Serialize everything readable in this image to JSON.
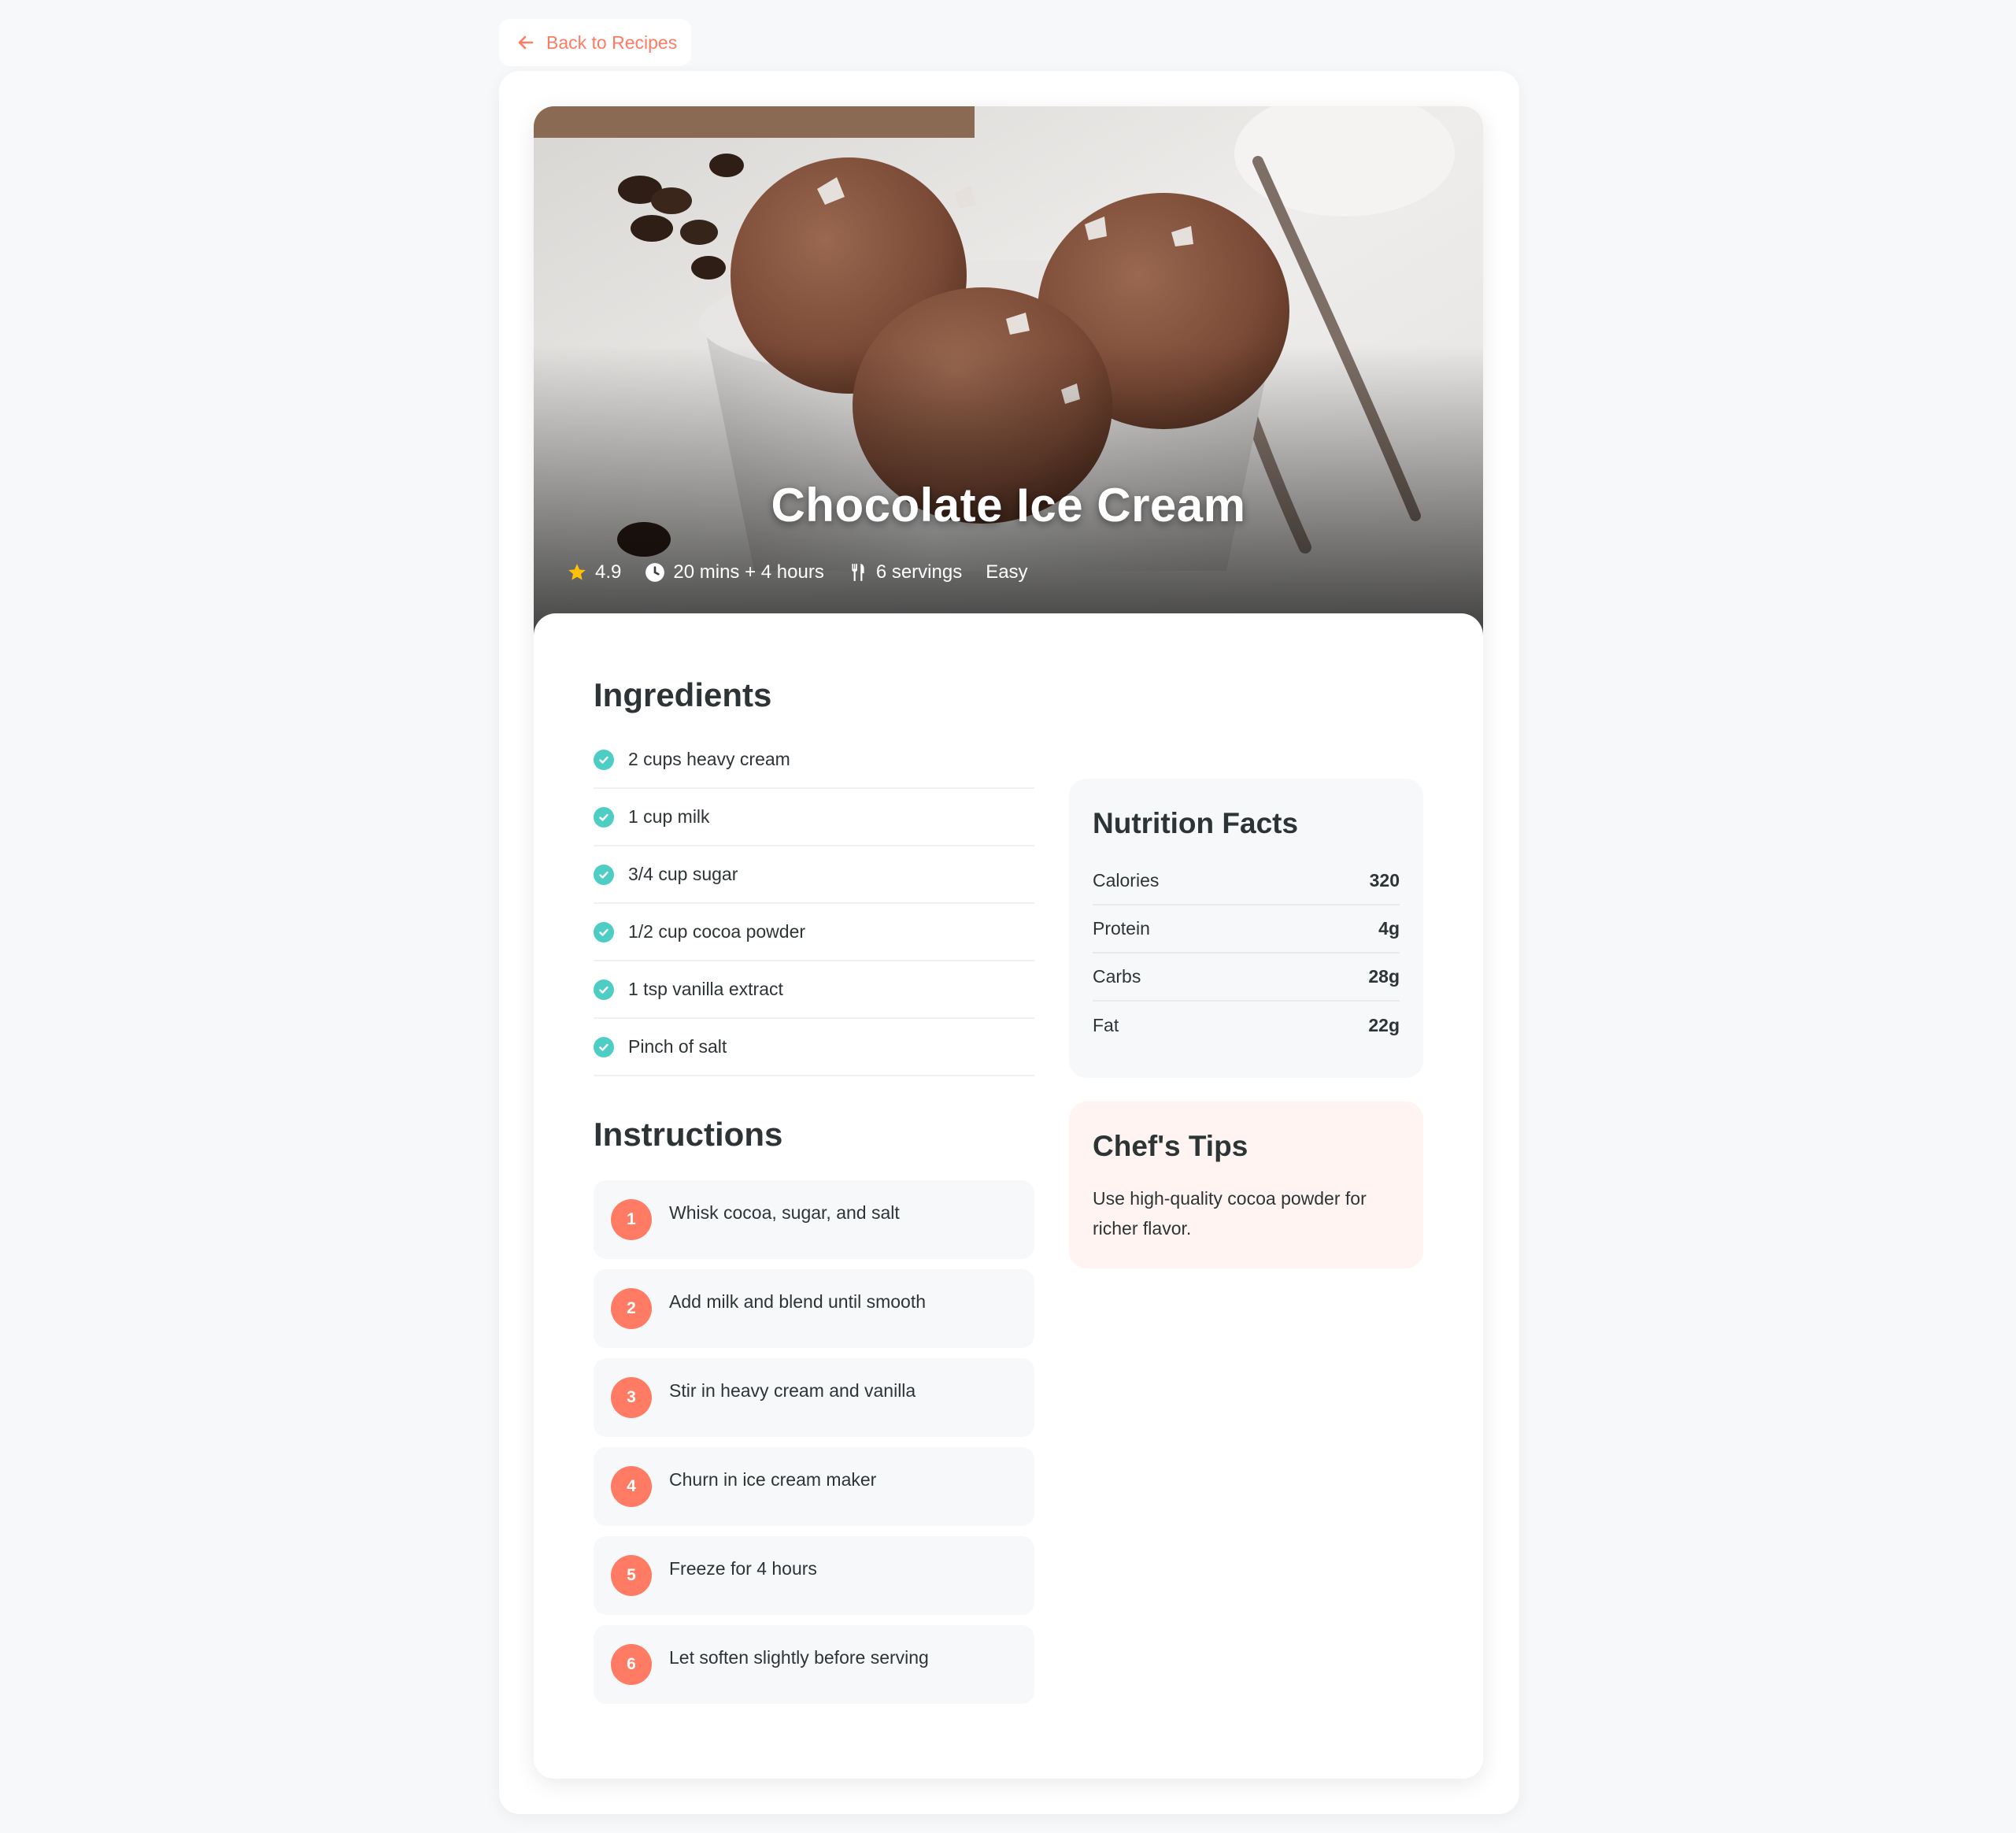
{
  "nav": {
    "back_label": "Back to Recipes"
  },
  "recipe": {
    "title": "Chocolate Ice Cream",
    "rating": "4.9",
    "time": "20 mins + 4 hours",
    "servings": "6 servings",
    "difficulty": "Easy"
  },
  "ingredients": {
    "title": "Ingredients",
    "items": [
      "2 cups heavy cream",
      "1 cup milk",
      "3/4 cup sugar",
      "1/2 cup cocoa powder",
      "1 tsp vanilla extract",
      "Pinch of salt"
    ]
  },
  "instructions": {
    "title": "Instructions",
    "steps": [
      {
        "num": "1",
        "text": "Whisk cocoa, sugar, and salt"
      },
      {
        "num": "2",
        "text": "Add milk and blend until smooth"
      },
      {
        "num": "3",
        "text": "Stir in heavy cream and vanilla"
      },
      {
        "num": "4",
        "text": "Churn in ice cream maker"
      },
      {
        "num": "5",
        "text": "Freeze for 4 hours"
      },
      {
        "num": "6",
        "text": "Let soften slightly before serving"
      }
    ]
  },
  "nutrition": {
    "title": "Nutrition Facts",
    "rows": [
      {
        "label": "Calories",
        "value": "320"
      },
      {
        "label": "Protein",
        "value": "4g"
      },
      {
        "label": "Carbs",
        "value": "28g"
      },
      {
        "label": "Fat",
        "value": "22g"
      }
    ]
  },
  "tips": {
    "title": "Chef's Tips",
    "text": "Use high-quality cocoa powder for richer flavor."
  },
  "icons": {
    "back": "arrow-left-icon",
    "rating": "star-icon",
    "time": "clock-icon",
    "servings": "utensils-icon",
    "ingredient": "check-circle-icon"
  },
  "colors": {
    "accent": "#ff7b63",
    "check": "#4ecdc4",
    "star": "#ffc107",
    "tips_bg": "#fff4f2",
    "panel_bg": "#f7f8fa"
  }
}
